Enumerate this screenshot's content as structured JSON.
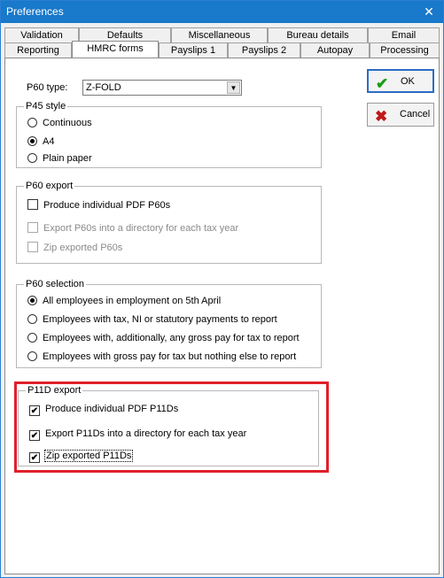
{
  "window": {
    "title": "Preferences",
    "close_glyph": "✕"
  },
  "tabs": {
    "back_row": [
      "Validation",
      "Defaults",
      "Miscellaneous",
      "Bureau details",
      "Email"
    ],
    "front_row": [
      "Reporting",
      "HMRC forms",
      "Payslips 1",
      "Payslips 2",
      "Autopay",
      "Processing"
    ],
    "active": "HMRC forms"
  },
  "buttons": {
    "ok_label": "OK",
    "cancel_label": "Cancel",
    "ok_icon": "checkmark-icon",
    "cancel_icon": "x-icon",
    "ok_color": "#1a9b1a",
    "cancel_color": "#c01818"
  },
  "p60_type": {
    "label": "P60 type:",
    "value": "Z-FOLD"
  },
  "p45_style": {
    "legend": "P45 style",
    "options": [
      "Continuous",
      "A4",
      "Plain paper"
    ],
    "selected": "A4"
  },
  "p60_export": {
    "legend": "P60 export",
    "items": [
      {
        "label": "Produce individual PDF P60s",
        "checked": false,
        "enabled": true
      },
      {
        "label": "Export P60s into a directory for each tax year",
        "checked": false,
        "enabled": false
      },
      {
        "label": "Zip exported P60s",
        "checked": false,
        "enabled": false
      }
    ]
  },
  "p60_selection": {
    "legend": "P60 selection",
    "options": [
      "All employees in employment on 5th April",
      "Employees with tax, NI or statutory payments to report",
      "Employees with, additionally, any gross pay for tax to report",
      "Employees with gross pay for tax but nothing else to report"
    ],
    "selected": "All employees in employment on 5th April"
  },
  "p11d_export": {
    "legend": "P11D export",
    "items": [
      {
        "label": "Produce individual PDF P11Ds",
        "checked": true,
        "enabled": true
      },
      {
        "label": "Export P11Ds into a directory for each tax year",
        "checked": true,
        "enabled": true
      },
      {
        "label": "Zip exported P11Ds",
        "checked": true,
        "enabled": true
      }
    ],
    "highlight_color": "#e0202a"
  }
}
